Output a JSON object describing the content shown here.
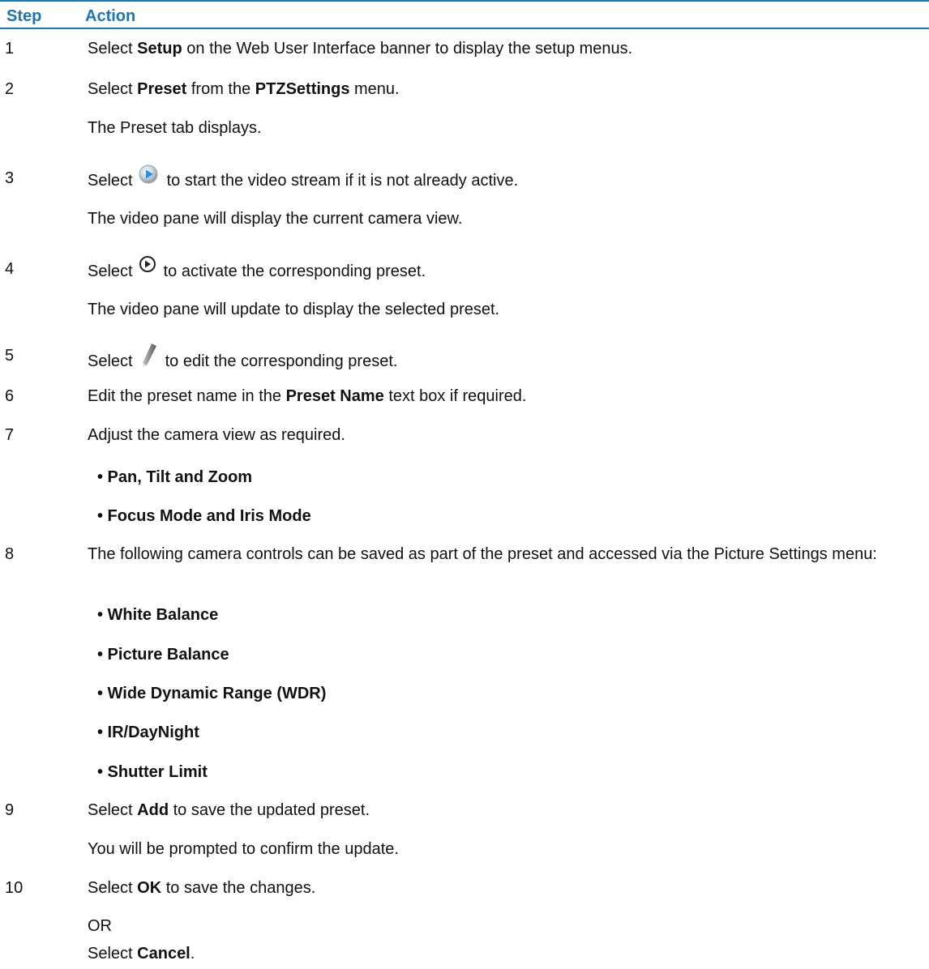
{
  "header": {
    "step": "Step",
    "action": "Action"
  },
  "steps": {
    "s1": {
      "num": "1",
      "pre": "Select ",
      "b1": "Setup",
      "post": " on the Web User Interface banner to display the setup menus."
    },
    "s2": {
      "num": "2",
      "pre": "Select ",
      "b1": "Preset",
      "mid": " from the ",
      "b2": "PTZSettings",
      "post": " menu.",
      "note": "The Preset tab displays."
    },
    "s3": {
      "num": "3",
      "pre": "Select",
      "icon": "play-stream-icon",
      "post": "to start the video stream if it is not already active.",
      "note": "The video pane will display the current camera view."
    },
    "s4": {
      "num": "4",
      "pre": "Select",
      "icon": "circle-play-icon",
      "post": "to activate the corresponding preset.",
      "note": "The video pane will update to display the selected preset."
    },
    "s5": {
      "num": "5",
      "pre": "Select",
      "icon": "pencil-icon",
      "post": "to edit the corresponding preset."
    },
    "s6": {
      "num": "6",
      "pre": "Edit the preset name in the ",
      "b1": "Preset Name",
      "post": " text box if required."
    },
    "s7": {
      "num": "7",
      "text": "Adjust the camera view as required.",
      "bullets": [
        "• Pan, Tilt and Zoom",
        "• Focus Mode and Iris Mode"
      ]
    },
    "s8": {
      "num": "8",
      "text": "The following camera controls can be saved as part of the preset and accessed via the Picture Settings menu:",
      "bullets": [
        "• White Balance",
        "• Picture Balance",
        "• Wide Dynamic Range (WDR)",
        "• IR/DayNight",
        "• Shutter Limit"
      ]
    },
    "s9": {
      "num": "9",
      "pre": "Select ",
      "b1": "Add",
      "post": " to save the updated preset.",
      "note": "You will be prompted to confirm the update."
    },
    "s10": {
      "num": "10",
      "pre": "Select ",
      "b1": "OK",
      "post": " to save the changes.",
      "or": "OR",
      "pre2": "Select ",
      "b2": "Cancel",
      "post2": "."
    }
  }
}
